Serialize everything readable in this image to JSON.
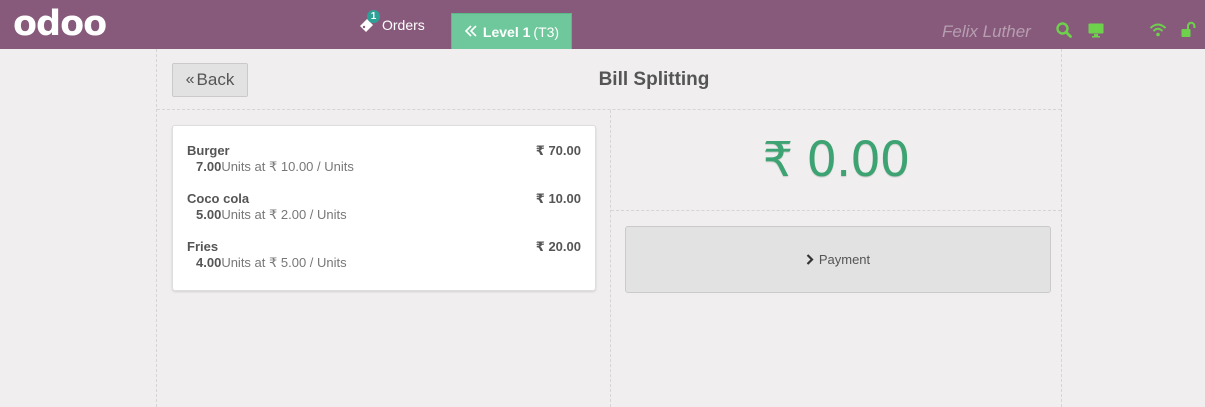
{
  "header": {
    "logo": "odoo",
    "orders_label": "Orders",
    "orders_count": "1",
    "level_label": "Level 1",
    "table_label": "(T3)",
    "username": "Felix Luther",
    "icons": [
      "search-icon",
      "monitor-icon",
      "wifi-icon",
      "unlock-icon"
    ]
  },
  "page": {
    "back_label": "Back",
    "title": "Bill Splitting"
  },
  "orderlines": [
    {
      "product": "Burger",
      "price": "₹ 70.00",
      "qty": "7.00",
      "detail": "Units at ₹ 10.00 / Units"
    },
    {
      "product": "Coco cola",
      "price": "₹ 10.00",
      "qty": "5.00",
      "detail": "Units at ₹ 2.00 / Units"
    },
    {
      "product": "Fries",
      "price": "₹ 20.00",
      "qty": "4.00",
      "detail": "Units at ₹ 5.00 / Units"
    }
  ],
  "total": "₹ 0.00",
  "payment_label": "Payment",
  "colors": {
    "brand": "#875a7b",
    "accent_green": "#6ec89b",
    "total_green": "#3da373",
    "icon_green": "#6ed14c"
  }
}
